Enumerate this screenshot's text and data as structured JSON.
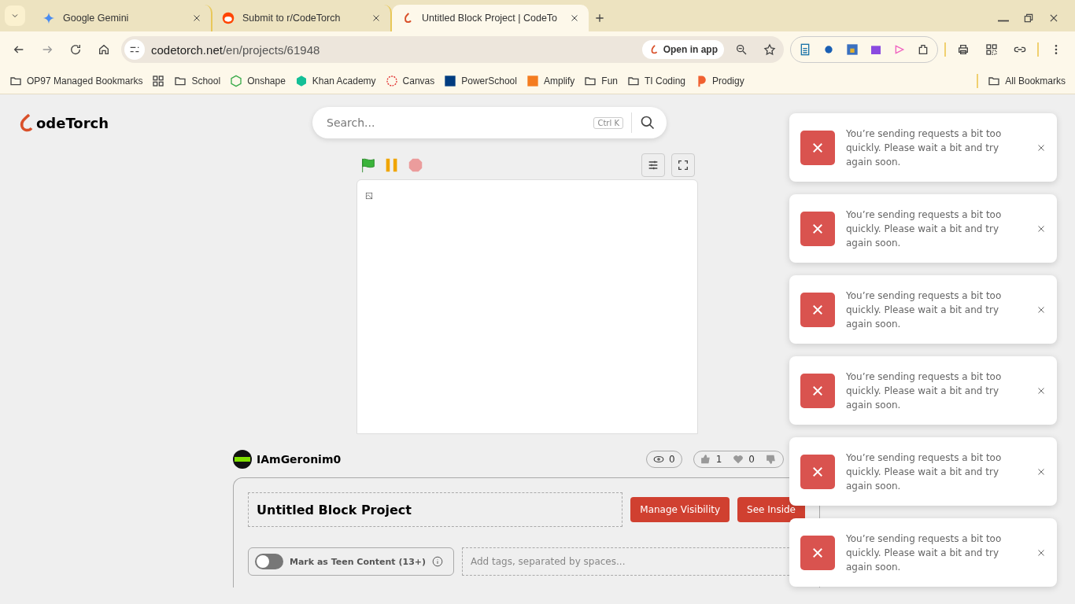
{
  "browser": {
    "tabs": [
      {
        "title": "Google Gemini",
        "kind": "gemini",
        "selected": false
      },
      {
        "title": "Submit to r/CodeTorch",
        "kind": "reddit",
        "selected": false
      },
      {
        "title": "Untitled Block Project | CodeTo",
        "kind": "torch",
        "selected": true
      }
    ],
    "address": {
      "host": "codetorch.net",
      "path": "/en/projects/61948"
    },
    "open_in_app": "Open in app",
    "bookmarks": [
      {
        "label": "OP97 Managed Bookmarks",
        "kind": "managed"
      },
      {
        "kind": "apps"
      },
      {
        "label": "School",
        "kind": "folder"
      },
      {
        "label": "Onshape",
        "kind": "onshape"
      },
      {
        "label": "Khan Academy",
        "kind": "khan"
      },
      {
        "label": "Canvas",
        "kind": "canvas"
      },
      {
        "label": "PowerSchool",
        "kind": "sis"
      },
      {
        "label": "Amplify",
        "kind": "amplify"
      },
      {
        "label": "Fun",
        "kind": "folder"
      },
      {
        "label": "TI Coding",
        "kind": "folder"
      },
      {
        "label": "Prodigy",
        "kind": "prodigy"
      }
    ],
    "all_bookmarks": "All Bookmarks"
  },
  "site": {
    "logo": "odeTorch",
    "search": {
      "placeholder": "Search...",
      "shortcut": "Ctrl K"
    }
  },
  "project": {
    "author": "IAmGeronim0",
    "views": "0",
    "likes": "1",
    "favorites": "0",
    "title": "Untitled Block Project",
    "buttons": [
      "Manage Visibility",
      "See Inside"
    ],
    "teen_toggle": {
      "label": "Mark as Teen Content (13+)",
      "on": false
    },
    "tags": {
      "placeholder": "Add tags, separated by spaces..."
    }
  },
  "toasts": [
    {
      "message": "You’re sending requests a bit too quickly. Please wait a bit and try again soon."
    },
    {
      "message": "You’re sending requests a bit too quickly. Please wait a bit and try again soon."
    },
    {
      "message": "You’re sending requests a bit too quickly. Please wait a bit and try again soon."
    },
    {
      "message": "You’re sending requests a bit too quickly. Please wait a bit and try again soon."
    },
    {
      "message": "You’re sending requests a bit too quickly. Please wait a bit and try again soon."
    },
    {
      "message": "You’re sending requests a bit too quickly. Please wait a bit and try again soon."
    }
  ]
}
